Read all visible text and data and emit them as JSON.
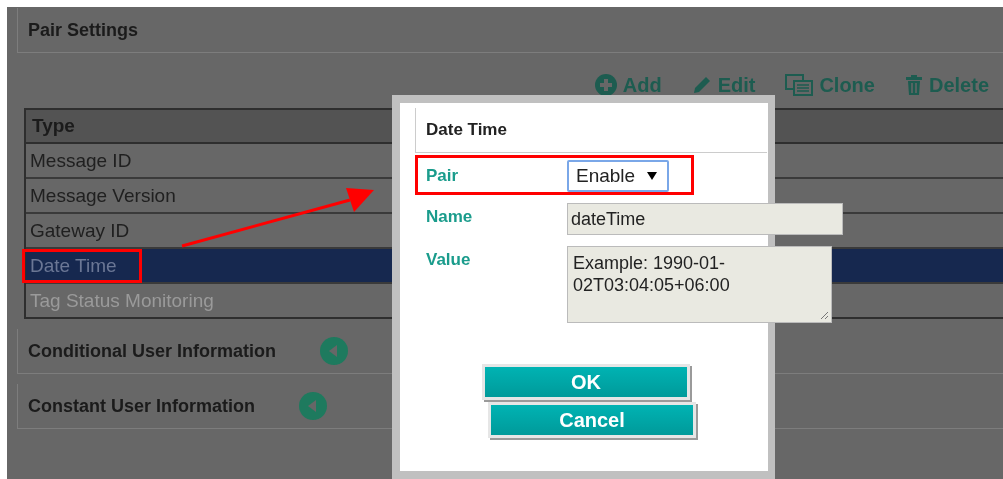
{
  "section": {
    "title": "Pair Settings"
  },
  "toolbar": [
    {
      "kind": "add",
      "label": "Add"
    },
    {
      "kind": "edit",
      "label": "Edit"
    },
    {
      "kind": "clone",
      "label": "Clone"
    },
    {
      "kind": "delete",
      "label": "Delete"
    }
  ],
  "table": {
    "columns": [
      "Type"
    ],
    "rows": [
      {
        "type": "Message ID",
        "selected": false,
        "disabled": false,
        "highlighted": false
      },
      {
        "type": "Message Version",
        "selected": false,
        "disabled": false,
        "highlighted": false
      },
      {
        "type": "Gateway ID",
        "selected": false,
        "disabled": false,
        "highlighted": false
      },
      {
        "type": "Date Time",
        "selected": true,
        "disabled": false,
        "highlighted": true
      },
      {
        "type": "Tag Status Monitoring",
        "selected": false,
        "disabled": true,
        "highlighted": false
      }
    ]
  },
  "sections": [
    {
      "title": "Conditional User Information"
    },
    {
      "title": "Constant User Information"
    }
  ],
  "dialog": {
    "title": "Date Time",
    "fields": [
      {
        "kind": "select",
        "label": "Pair",
        "value": "Enable",
        "highlighted": true
      },
      {
        "kind": "input",
        "label": "Name",
        "value": "dateTime",
        "highlighted": false
      },
      {
        "kind": "textarea",
        "label": "Value",
        "value": "Example: 1990-01-02T03:04:05+06:00",
        "highlighted": false
      }
    ],
    "buttons": [
      "OK",
      "Cancel"
    ]
  }
}
